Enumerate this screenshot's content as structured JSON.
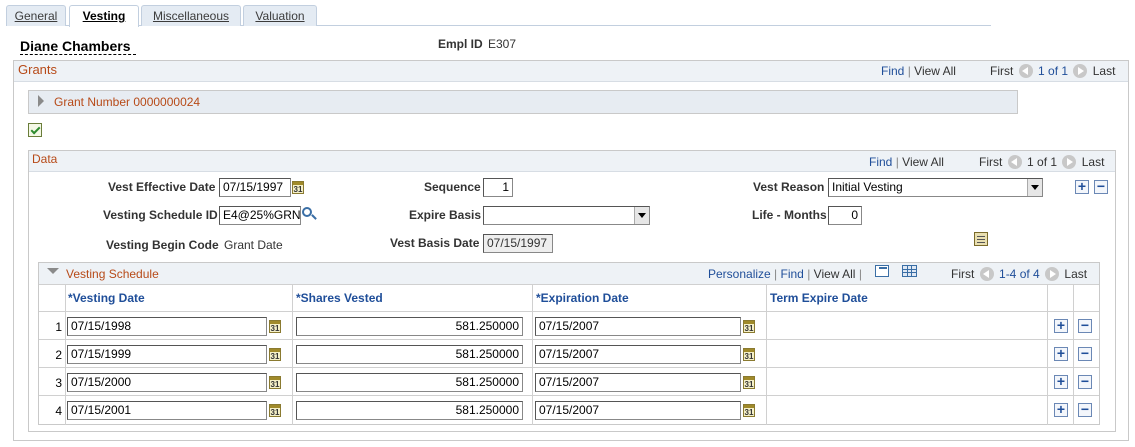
{
  "tabs": [
    "General",
    "Vesting",
    "Miscellaneous",
    "Valuation"
  ],
  "active_tab": "Vesting",
  "employee": {
    "name": "Diane Chambers",
    "empl_id_label": "Empl ID",
    "empl_id": "E307"
  },
  "grants": {
    "title": "Grants",
    "find": "Find",
    "view_all": "View All",
    "first": "First",
    "count": "1 of 1",
    "last": "Last",
    "grant_number_label": "Grant Number 0000000024"
  },
  "data_section": {
    "title": "Data",
    "find": "Find",
    "view_all": "View All",
    "first": "First",
    "count": "1 of 1",
    "last": "Last",
    "vest_effective_date_label": "Vest Effective Date",
    "vest_effective_date": "07/15/1997",
    "sequence_label": "Sequence",
    "sequence": "1",
    "vest_reason_label": "Vest Reason",
    "vest_reason": "Initial Vesting",
    "vesting_schedule_id_label": "Vesting Schedule ID",
    "vesting_schedule_id": "E4@25%GRN",
    "expire_basis_label": "Expire Basis",
    "expire_basis": "",
    "life_months_label": "Life - Months",
    "life_months": "0",
    "vesting_begin_code_label": "Vesting Begin Code",
    "vesting_begin_code": "Grant Date",
    "vest_basis_date_label": "Vest Basis Date",
    "vest_basis_date": "07/15/1997"
  },
  "schedule": {
    "title": "Vesting Schedule",
    "personalize": "Personalize",
    "find": "Find",
    "view_all": "View All",
    "first": "First",
    "count": "1-4 of 4",
    "last": "Last",
    "columns": [
      "*Vesting Date",
      "*Shares Vested",
      "*Expiration Date",
      "Term Expire Date"
    ],
    "rows": [
      {
        "num": "1",
        "vesting_date": "07/15/1998",
        "shares": "581.250000",
        "expiration": "07/15/2007"
      },
      {
        "num": "2",
        "vesting_date": "07/15/1999",
        "shares": "581.250000",
        "expiration": "07/15/2007"
      },
      {
        "num": "3",
        "vesting_date": "07/15/2000",
        "shares": "581.250000",
        "expiration": "07/15/2007"
      },
      {
        "num": "4",
        "vesting_date": "07/15/2001",
        "shares": "581.250000",
        "expiration": "07/15/2007"
      }
    ]
  },
  "calendar_glyph": "31",
  "colors": {
    "section_title": "#b74a18",
    "link": "#1f4e99",
    "header_bg": "#eef2f6"
  }
}
